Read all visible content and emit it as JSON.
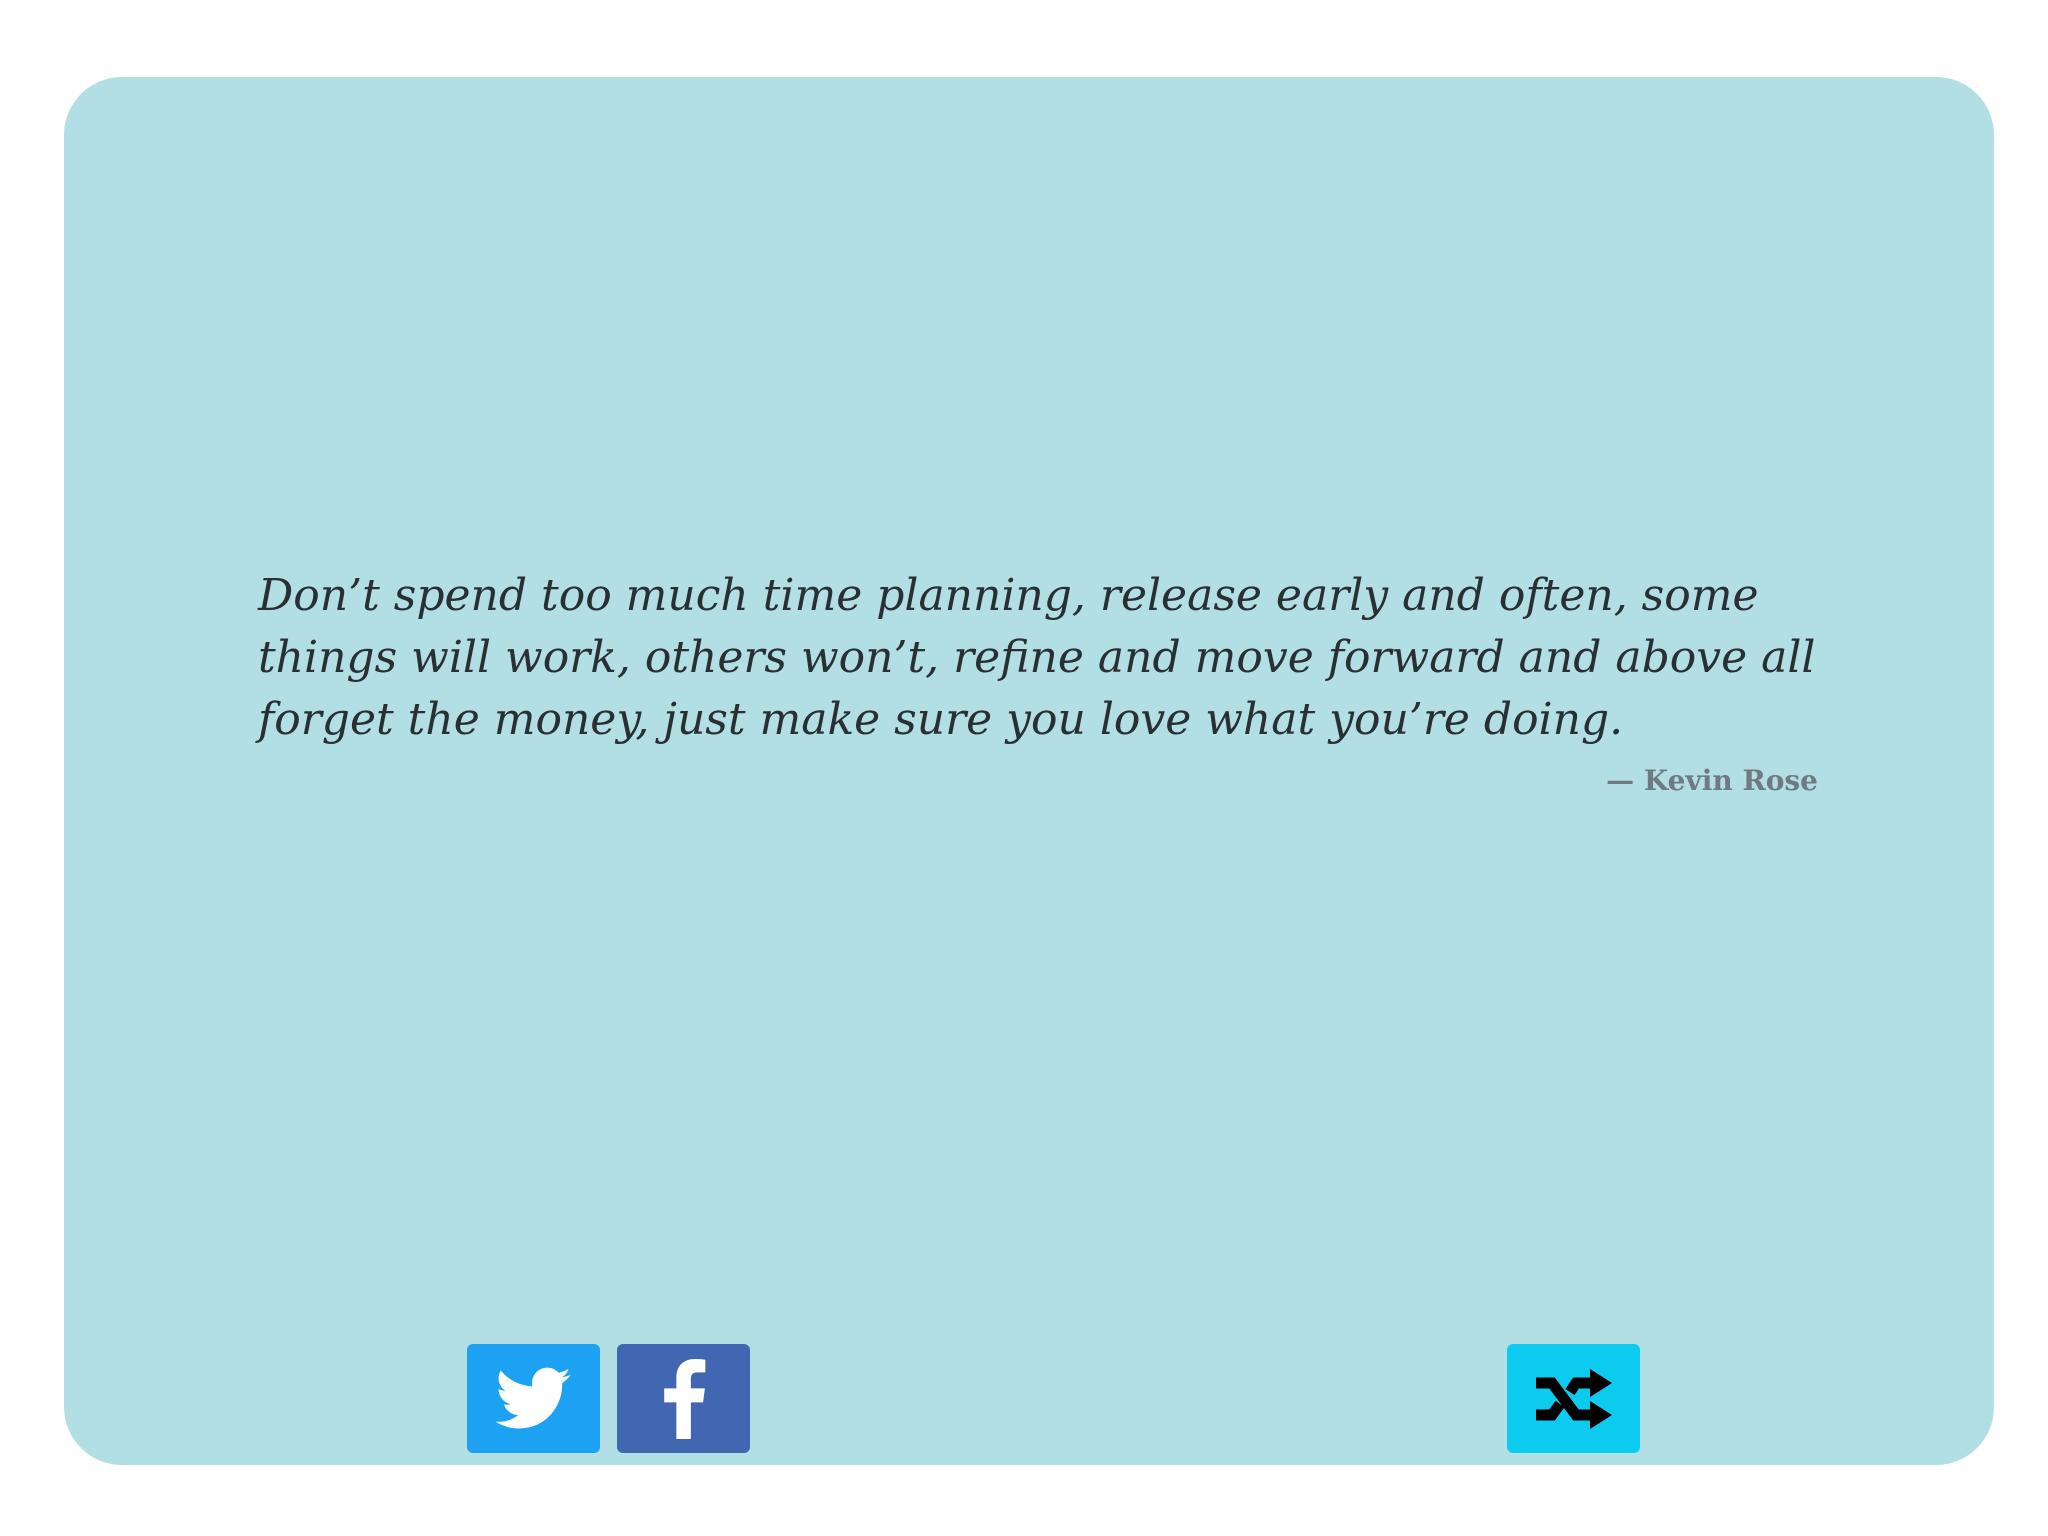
{
  "colors": {
    "card_background": "#b1dfe4",
    "twitter": "#1da1f2",
    "facebook": "#4267b2",
    "shuffle": "#0ccbee",
    "quote_text": "#2a2f33",
    "author_text": "#707a80"
  },
  "quote": {
    "text": "Don’t spend too much time planning, release early and often, some things will work, others won’t, refine and move forward and above all forget the money, just make sure you love what you’re doing.",
    "author": "— Kevin Rose"
  },
  "buttons": {
    "twitter_icon": "twitter-bird-icon",
    "facebook_icon": "facebook-f-icon",
    "shuffle_icon": "shuffle-icon"
  }
}
